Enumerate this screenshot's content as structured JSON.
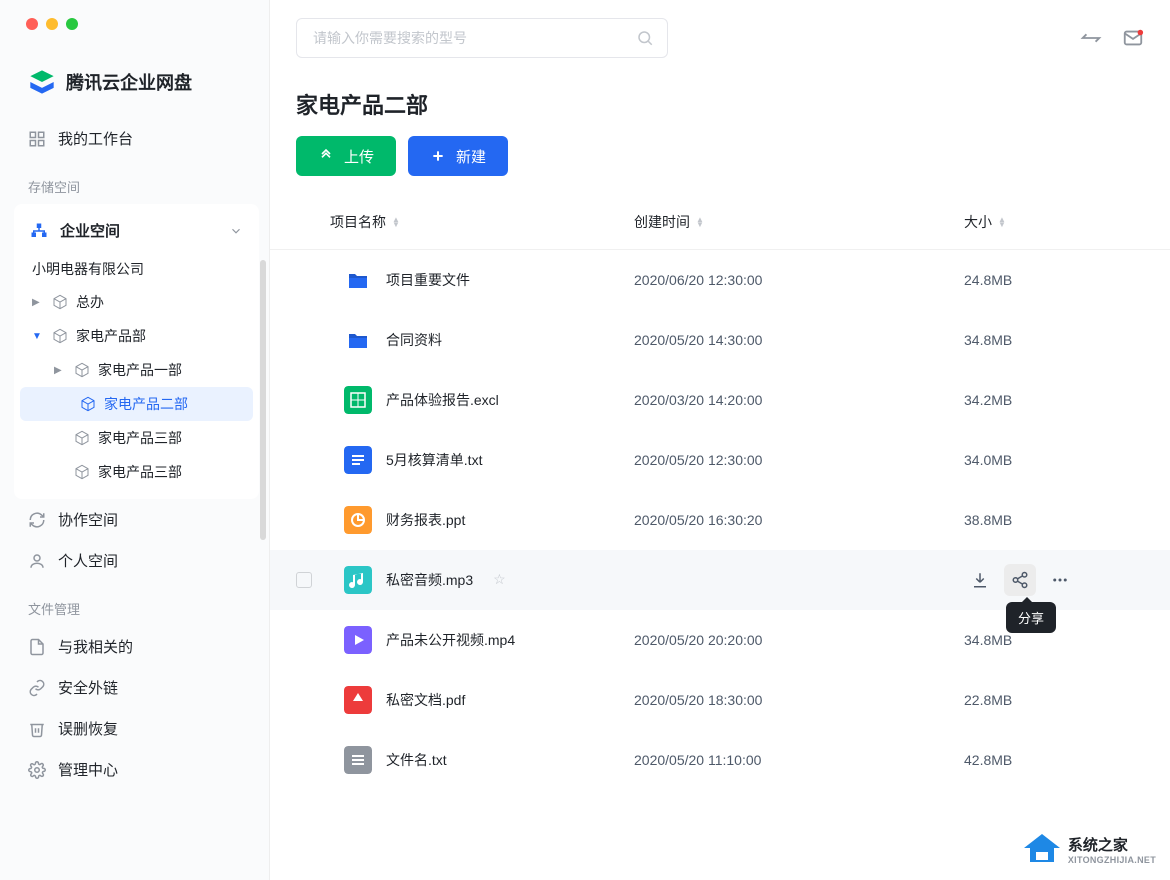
{
  "brand": "腾讯云企业网盘",
  "search": {
    "placeholder": "请输入你需要搜索的型号"
  },
  "sidebar": {
    "workbench": "我的工作台",
    "section_storage": "存储空间",
    "enterprise_space": "企业空间",
    "company": "小明电器有限公司",
    "tree": [
      {
        "label": "总办",
        "depth": 0,
        "expanded": false
      },
      {
        "label": "家电产品部",
        "depth": 0,
        "expanded": true
      },
      {
        "label": "家电产品一部",
        "depth": 1
      },
      {
        "label": "家电产品二部",
        "depth": 1,
        "active": true
      },
      {
        "label": "家电产品三部",
        "depth": 1
      },
      {
        "label": "家电产品三部",
        "depth": 1
      }
    ],
    "collab_space": "协作空间",
    "personal_space": "个人空间",
    "section_file_mgmt": "文件管理",
    "file_nav": [
      "与我相关的",
      "安全外链",
      "误删恢复",
      "管理中心"
    ]
  },
  "page": {
    "title": "家电产品二部",
    "upload": "上传",
    "create": "新建"
  },
  "columns": {
    "name": "项目名称",
    "date": "创建时间",
    "size": "大小"
  },
  "files": [
    {
      "icon": "folder",
      "color": "#2468f2",
      "name": "项目重要文件",
      "date": "2020/06/20 12:30:00",
      "size": "24.8MB"
    },
    {
      "icon": "folder",
      "color": "#2468f2",
      "name": "合同资料",
      "date": "2020/05/20 14:30:00",
      "size": "34.8MB"
    },
    {
      "icon": "sheet",
      "color": "#00b96b",
      "name": "产品体验报告.excl",
      "date": "2020/03/20 14:20:00",
      "size": "34.2MB"
    },
    {
      "icon": "doc",
      "color": "#2468f2",
      "name": "5月核算清单.txt",
      "date": "2020/05/20 12:30:00",
      "size": "34.0MB"
    },
    {
      "icon": "ppt",
      "color": "#ff9a2e",
      "name": "财务报表.ppt",
      "date": "2020/05/20 16:30:20",
      "size": "38.8MB"
    },
    {
      "icon": "audio",
      "color": "#2bc6c6",
      "name": "私密音频.mp3",
      "date": "",
      "size": "",
      "hovered": true
    },
    {
      "icon": "video",
      "color": "#7b61ff",
      "name": "产品未公开视频.mp4",
      "date": "2020/05/20 20:20:00",
      "size": "34.8MB"
    },
    {
      "icon": "pdf",
      "color": "#ed3b3b",
      "name": "私密文档.pdf",
      "date": "2020/05/20 18:30:00",
      "size": "22.8MB"
    },
    {
      "icon": "txt",
      "color": "#8f959e",
      "name": "文件名.txt",
      "date": "2020/05/20 11:10:00",
      "size": "42.8MB"
    }
  ],
  "tooltip_share": "分享",
  "watermark": {
    "cn": "系统之家",
    "en": "XITONGZHIJIA.NET"
  }
}
